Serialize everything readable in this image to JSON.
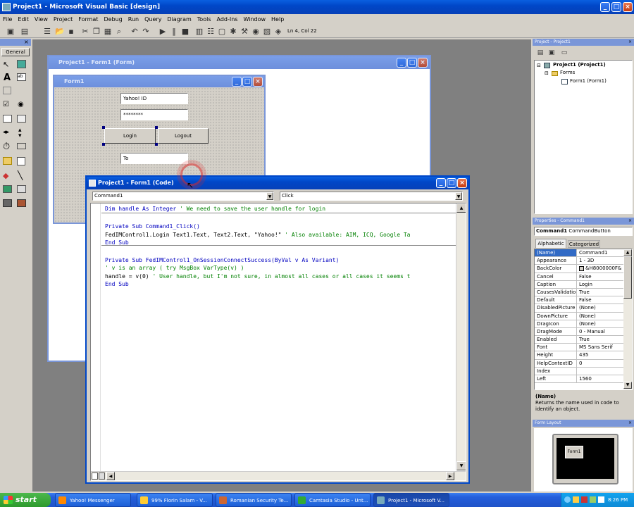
{
  "app": {
    "title": "Project1 - Microsoft Visual Basic [design]"
  },
  "menu": [
    "File",
    "Edit",
    "View",
    "Project",
    "Format",
    "Debug",
    "Run",
    "Query",
    "Diagram",
    "Tools",
    "Add-Ins",
    "Window",
    "Help"
  ],
  "toolbar": {
    "position_text": "Ln 4, Col 22"
  },
  "toolbox": {
    "tab_label": "General"
  },
  "form_designer": {
    "title": "Project1 - Form1 (Form)",
    "form_title": "Form1",
    "text1_value": "Yahoo! ID",
    "text2_value": "********",
    "login_label": "Login",
    "logout_label": "Logout",
    "text3_value": "To"
  },
  "code_window": {
    "title": "Project1 - Form1 (Code)",
    "object_combo": "Command1",
    "proc_combo": "Click",
    "lines": [
      {
        "parts": [
          {
            "t": "Dim handle As Integer ",
            "c": "kw"
          },
          {
            "t": "' We need to save the user handle for login",
            "c": "cm"
          }
        ]
      },
      {
        "parts": []
      },
      {
        "parts": [
          {
            "t": "Private Sub Command1_Click()",
            "c": "kw"
          }
        ]
      },
      {
        "parts": [
          {
            "t": "FedIMControl1.Login Text1.Text, Text2.Text, \"Yahoo!\" ",
            "c": ""
          },
          {
            "t": "' Also available: AIM, ICQ, Google Ta",
            "c": "cm"
          }
        ]
      },
      {
        "parts": [
          {
            "t": "End Sub",
            "c": "kw"
          }
        ]
      },
      {
        "parts": []
      },
      {
        "parts": [
          {
            "t": "Private Sub FedIMControl1_OnSessionConnectSuccess(ByVal v As Variant)",
            "c": "kw"
          }
        ]
      },
      {
        "parts": [
          {
            "t": "' v is an array ( try MsgBox VarType(v) )",
            "c": "cm"
          }
        ]
      },
      {
        "parts": [
          {
            "t": "handle = v(0) ",
            "c": ""
          },
          {
            "t": "' User handle, but I'm not sure, in almost all cases or all cases it seems t",
            "c": "cm"
          }
        ]
      },
      {
        "parts": [
          {
            "t": "End Sub",
            "c": "kw"
          }
        ]
      }
    ]
  },
  "project_explorer": {
    "title": "Project - Project1",
    "root": "Project1 (Project1)",
    "folder": "Forms",
    "item": "Form1 (Form1)"
  },
  "properties": {
    "title": "Properties - Command1",
    "object_name": "Command1",
    "object_type": "CommandButton",
    "tab_alpha": "Alphabetic",
    "tab_cat": "Categorized",
    "rows": [
      {
        "n": "(Name)",
        "v": "Command1"
      },
      {
        "n": "Appearance",
        "v": "1 - 3D"
      },
      {
        "n": "BackColor",
        "v": "&H8000000F&"
      },
      {
        "n": "Cancel",
        "v": "False"
      },
      {
        "n": "Caption",
        "v": "Login"
      },
      {
        "n": "CausesValidation",
        "v": "True"
      },
      {
        "n": "Default",
        "v": "False"
      },
      {
        "n": "DisabledPicture",
        "v": "(None)"
      },
      {
        "n": "DownPicture",
        "v": "(None)"
      },
      {
        "n": "DragIcon",
        "v": "(None)"
      },
      {
        "n": "DragMode",
        "v": "0 - Manual"
      },
      {
        "n": "Enabled",
        "v": "True"
      },
      {
        "n": "Font",
        "v": "MS Sans Serif"
      },
      {
        "n": "Height",
        "v": "435"
      },
      {
        "n": "HelpContextID",
        "v": "0"
      },
      {
        "n": "Index",
        "v": ""
      },
      {
        "n": "Left",
        "v": "1560"
      }
    ],
    "desc_title": "(Name)",
    "desc_text": "Returns the name used in code to identify an object."
  },
  "form_layout": {
    "title": "Form Layout",
    "form_label": "Form1"
  },
  "taskbar": {
    "start_label": "start",
    "buttons": [
      "Yahoo! Messenger",
      "99% Florin Salam - V...",
      "Romanian Security Te...",
      "Camtasia Studio - Unt...",
      "Project1 - Microsoft V..."
    ],
    "clock": "8:26 PM"
  }
}
